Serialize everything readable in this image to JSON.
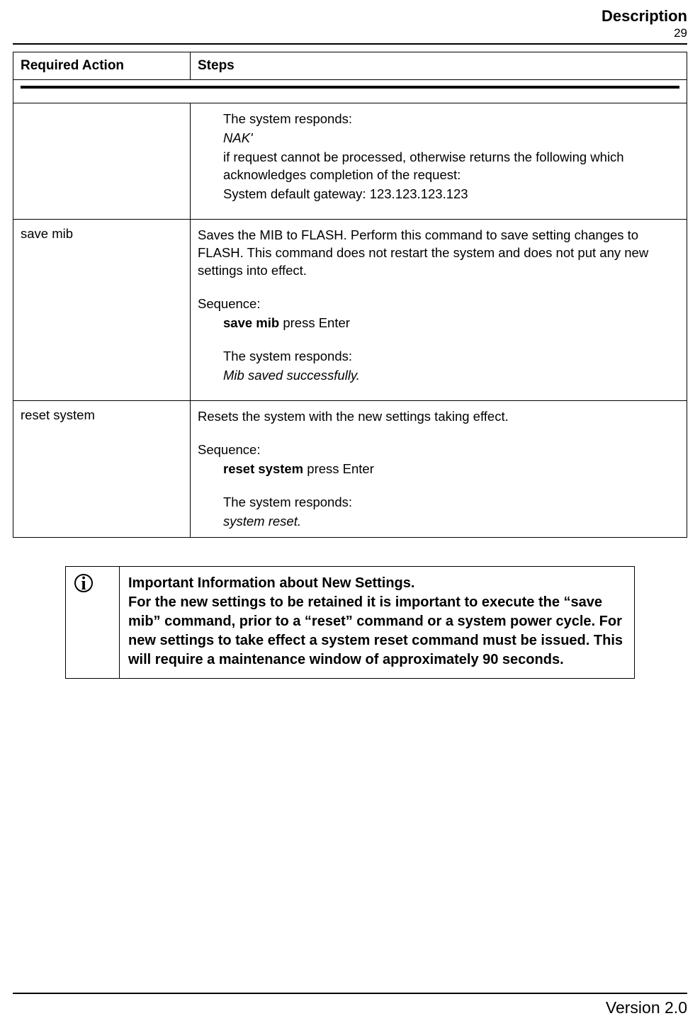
{
  "header": {
    "title": "Description",
    "page_number": "29"
  },
  "table": {
    "col_action": "Required Action",
    "col_steps": "Steps",
    "rows": [
      {
        "action": "",
        "r1": "The system responds:",
        "r2": "NAK'",
        "r3": "if request cannot be processed, otherwise returns the following which acknowledges completion of the request:",
        "r4": "System default gateway: 123.123.123.123"
      },
      {
        "action": "save mib",
        "d1": "Saves the MIB to FLASH. Perform this command to save setting changes to FLASH. This command does not restart the system and does not put any new settings into effect.",
        "seq_label": "Sequence:",
        "seq_cmd_bold": "save mib",
        "seq_cmd_rest": " press Enter",
        "resp_label": "The system responds:",
        "resp_text": "Mib saved successfully."
      },
      {
        "action": "reset system",
        "d1": "Resets the system with the new settings taking effect.",
        "seq_label": "Sequence:",
        "seq_cmd_bold": "reset system",
        "seq_cmd_rest": " press Enter",
        "resp_label": "The system responds:",
        "resp_text": "system reset."
      }
    ]
  },
  "info": {
    "title": "Important Information about New Settings.",
    "body": "For the new settings to be retained it is important to execute the “save mib” command, prior to a “reset” command or a system power cycle. For new settings to take effect a system reset command must be issued. This will require a maintenance window of approximately 90 seconds."
  },
  "footer": {
    "version": "Version 2.0"
  }
}
